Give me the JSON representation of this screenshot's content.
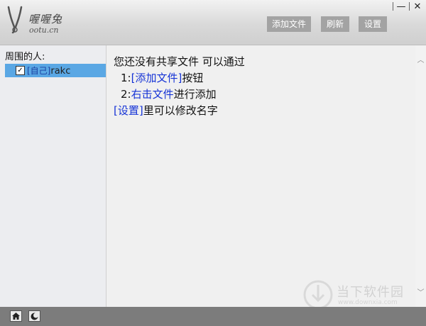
{
  "app": {
    "brand_name": "喔喔兔",
    "brand_domain": "ootu.cn"
  },
  "toolbar": {
    "add_file": "添加文件",
    "refresh": "刷新",
    "settings": "设置"
  },
  "window_controls": {
    "minimize": "—",
    "close": "✕"
  },
  "sidebar": {
    "title": "周围的人:",
    "peers": [
      {
        "tag": "[自己]",
        "name": "rakc",
        "checked": true
      }
    ]
  },
  "main": {
    "line1": "您还没有共享文件 可以通过",
    "step1_prefix": "1:",
    "step1_link": "[添加文件]",
    "step1_suffix": "按钮",
    "step2_prefix": "2:",
    "step2_link": "右击文件",
    "step2_suffix": "进行添加",
    "line4_link": "[设置]",
    "line4_suffix": "里可以修改名字"
  },
  "footer": {
    "home_icon": "home-icon",
    "about_icon": "moon-icon"
  },
  "watermark": {
    "text": "当下软件园",
    "url": "www.downxia.com"
  },
  "colors": {
    "selection": "#5aa7e4",
    "link": "#1533d6",
    "toolbar_button": "#a3a3a3",
    "footer": "#7c7c7c"
  }
}
